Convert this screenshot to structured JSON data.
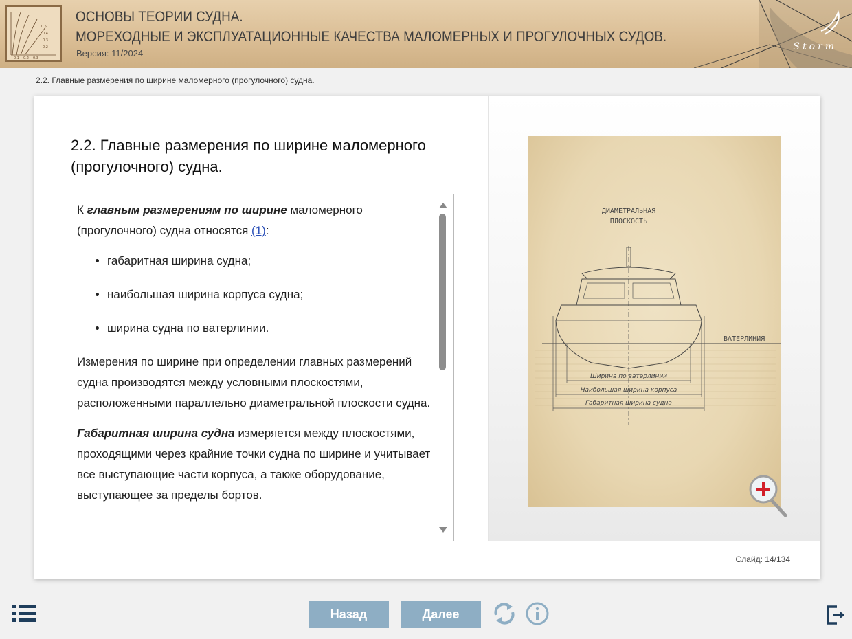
{
  "header": {
    "title_line1": "ОСНОВЫ ТЕОРИИ СУДНА.",
    "title_line2": "МОРЕХОДНЫЕ И ЭКСПЛУАТАЦИОННЫЕ КАЧЕСТВА МАЛОМЕРНЫХ И ПРОГУЛОЧНЫХ СУДОВ.",
    "version": "Версия: 11/2024",
    "brand": "Storm"
  },
  "breadcrumb": "2.2. Главные размерения по ширине маломерного (прогулочного) судна.",
  "slide": {
    "title": "2.2. Главные размерения по ширине маломерного (прогулочного) судна.",
    "intro_prefix": "К ",
    "intro_bold": "главным размерениям по ширине",
    "intro_suffix": " маломерного (прогулочного) судна относятся ",
    "intro_link": "(1)",
    "intro_end": ":",
    "bullets": [
      "габаритная ширина судна;",
      "наибольшая ширина корпуса судна;",
      "ширина судна по ватерлинии."
    ],
    "para2": "Измерения по ширине при определении главных размерений судна производятся между условными плоскостями, расположенными параллельно диаметральной плоскости судна.",
    "para3_bold": "Габаритная ширина судна",
    "para3_text": "  измеряется между плоскостями, проходящими через крайние точки судна по ширине и учитывает все выступающие части корпуса, а также оборудование, выступающее за пределы бортов."
  },
  "drawing": {
    "label_dp_1": "ДИАМЕТРАЛЬНАЯ",
    "label_dp_2": "ПЛОСКОСТЬ",
    "label_waterline": "ВАТЕРЛИНИЯ",
    "dim_waterline": "Ширина по ватерлинии",
    "dim_hull": "Наибольшая ширина корпуса",
    "dim_overall": "Габаритная ширина судна"
  },
  "counter": {
    "label": "Слайд:",
    "current": "14",
    "separator": "/",
    "total": "134"
  },
  "nav": {
    "back": "Назад",
    "next": "Далее"
  },
  "icons": {
    "menu": "list-menu-icon",
    "reload": "reload-icon",
    "info": "info-icon",
    "exit": "exit-icon",
    "zoom": "zoom-in-icon"
  },
  "colors": {
    "nav_button": "#8eaec4",
    "header_bg": "#dcc098",
    "link": "#2a4fb8",
    "accent_dark": "#1f3e5c",
    "zoom_plus": "#d21f2a"
  }
}
